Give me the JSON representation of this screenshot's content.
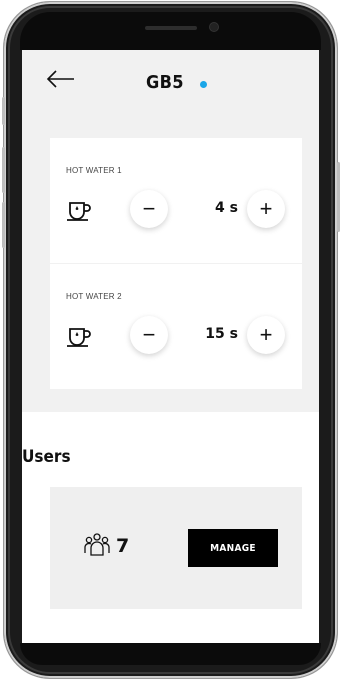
{
  "header": {
    "title": "GB5",
    "status_color": "#1aa6e8"
  },
  "hot_water": [
    {
      "label": "HOT WATER 1",
      "value": "4 s"
    },
    {
      "label": "HOT WATER 2",
      "value": "15 s"
    }
  ],
  "controls": {
    "minus": "−",
    "plus": "+"
  },
  "users": {
    "title": "Users",
    "count": "7",
    "manage_label": "MANAGE"
  },
  "icons": {
    "back": "arrow-left-icon",
    "cup": "cup-icon",
    "people": "people-icon"
  }
}
